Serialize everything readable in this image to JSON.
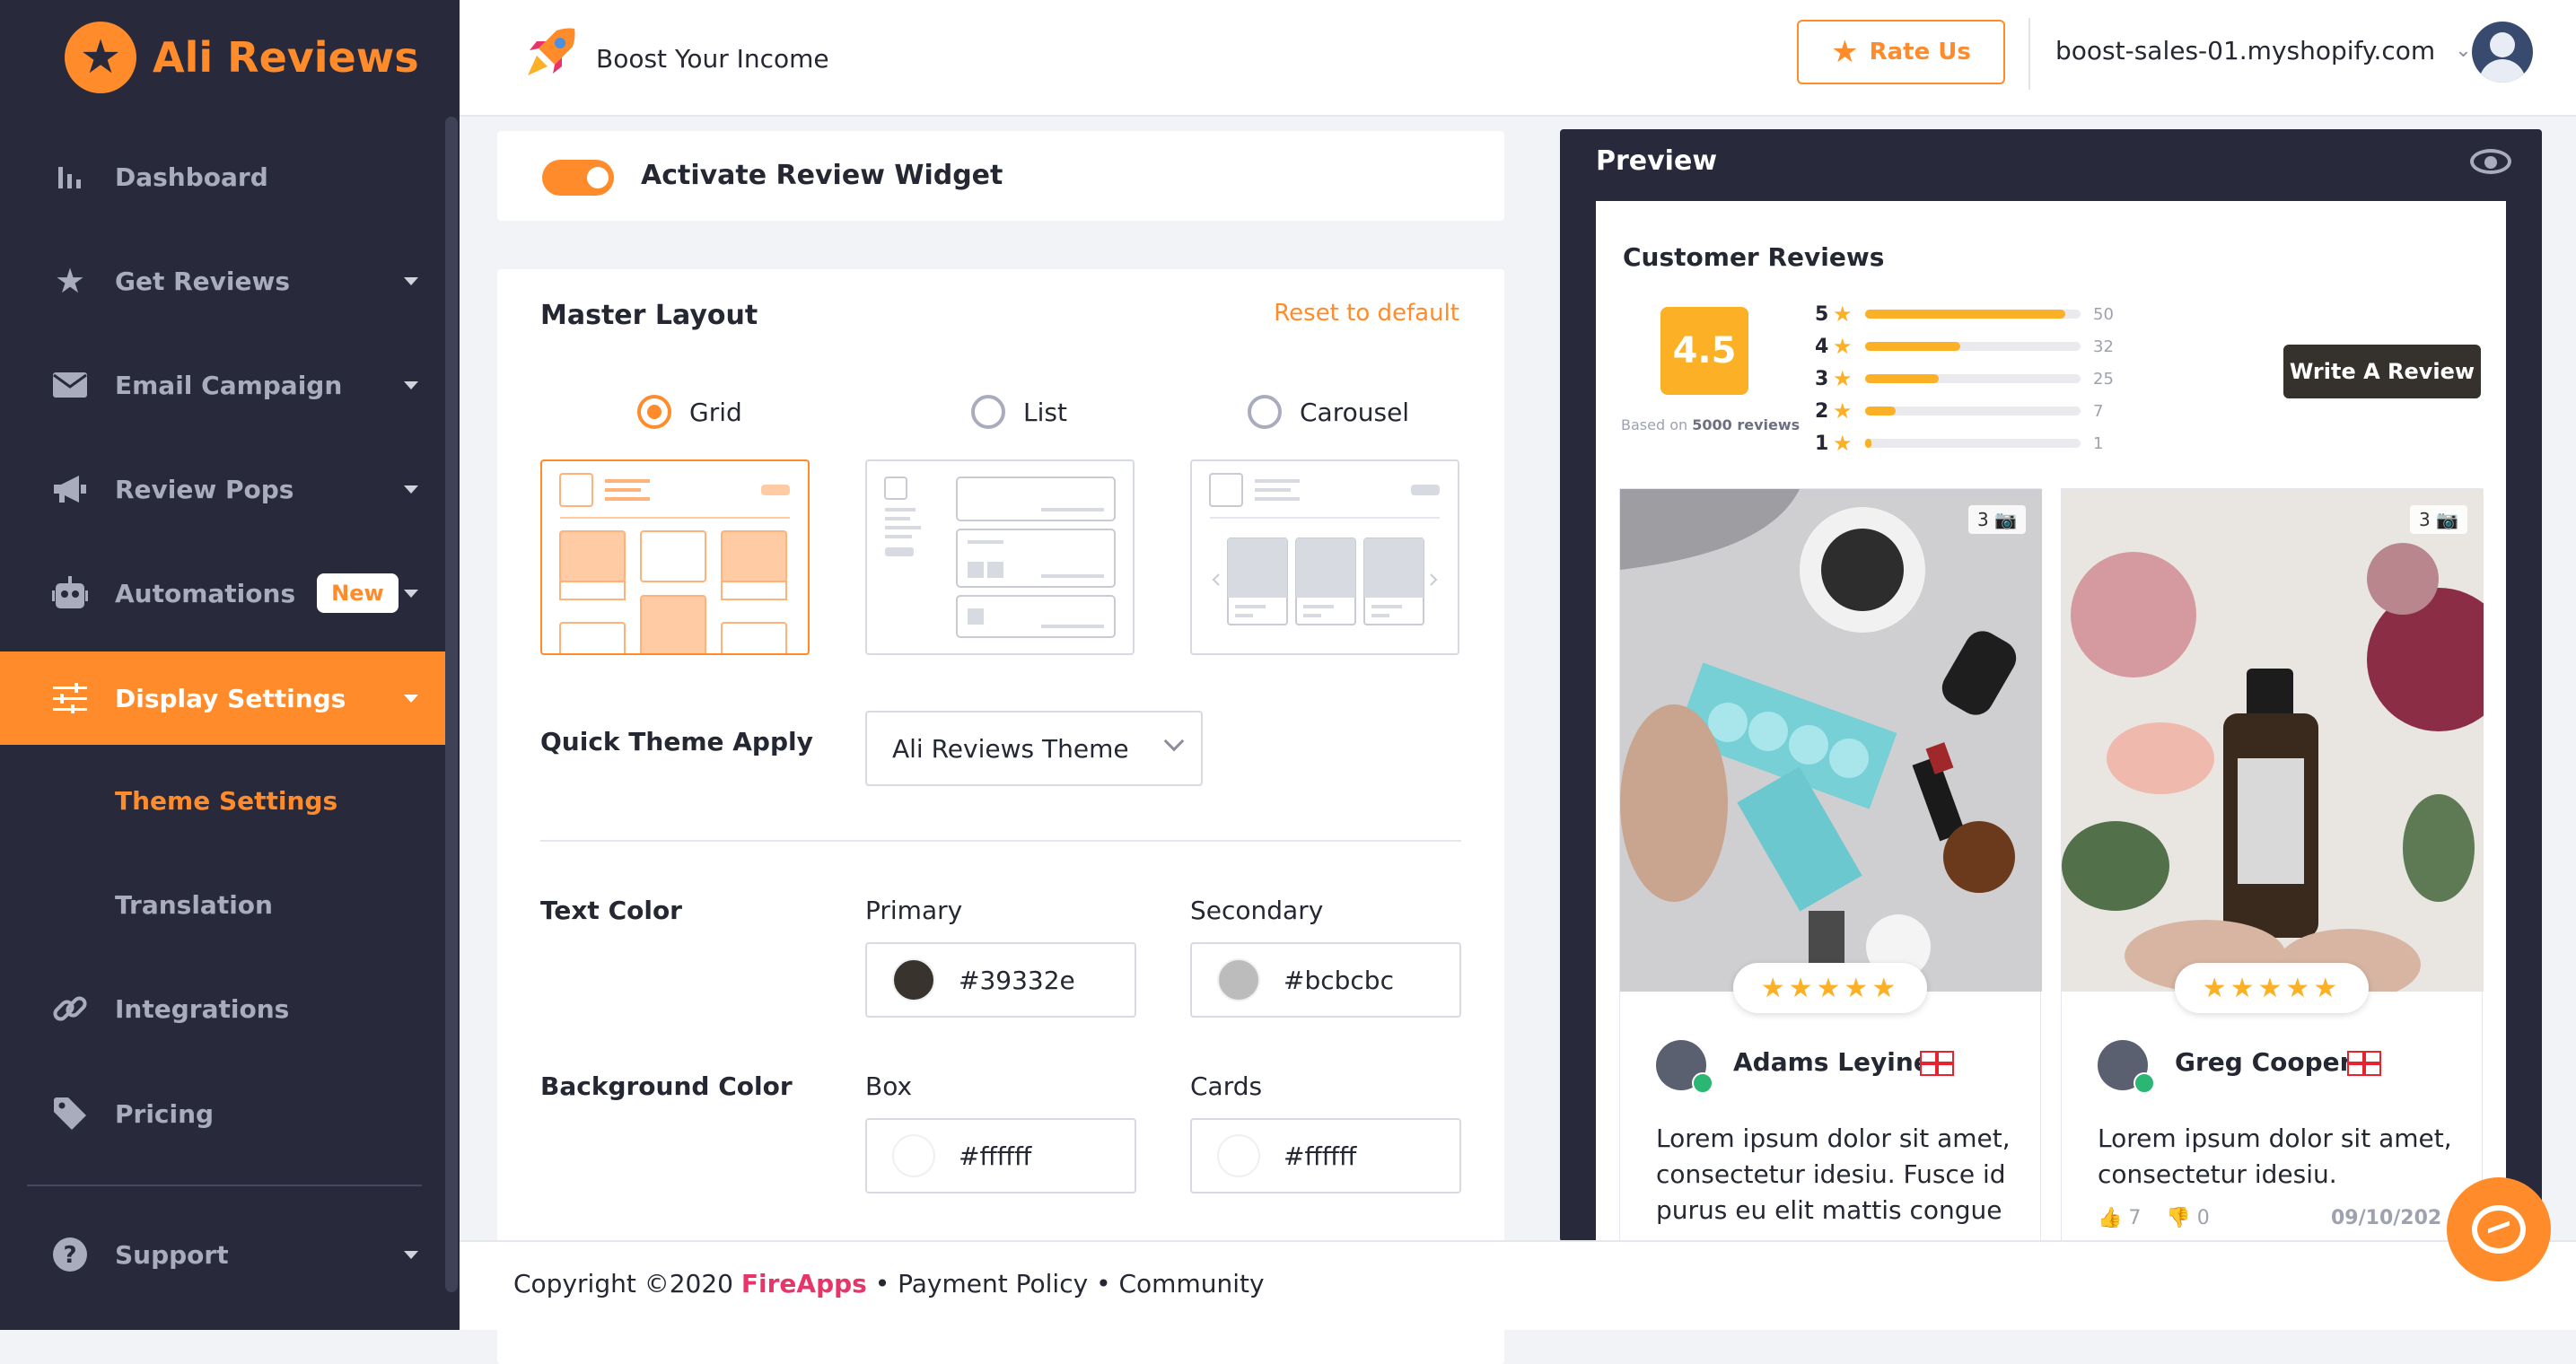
{
  "app": {
    "brand": "Ali Reviews"
  },
  "sidebar": {
    "items": [
      {
        "label": "Dashboard",
        "icon": "bar-chart-icon"
      },
      {
        "label": "Get Reviews",
        "icon": "star-icon"
      },
      {
        "label": "Email Campaign",
        "icon": "envelope-icon"
      },
      {
        "label": "Review Pops",
        "icon": "megaphone-icon"
      },
      {
        "label": "Automations",
        "icon": "robot-icon",
        "badge": "New"
      },
      {
        "label": "Display Settings",
        "icon": "sliders-icon"
      },
      {
        "label": "Integrations",
        "icon": "link-icon"
      },
      {
        "label": "Pricing",
        "icon": "tag-icon"
      },
      {
        "label": "Support",
        "icon": "question-icon"
      }
    ],
    "sub_items": [
      "Theme Settings",
      "Translation"
    ]
  },
  "header": {
    "boost": "Boost Your Income",
    "rate_us": "Rate Us",
    "store": "boost-sales-01.myshopify.com"
  },
  "widget": {
    "toggle_label": "Activate Review Widget",
    "enabled": true
  },
  "layout": {
    "title": "Master Layout",
    "reset": "Reset to default",
    "options": [
      "Grid",
      "List",
      "Carousel"
    ],
    "selected": "Grid"
  },
  "theme": {
    "label": "Quick Theme Apply",
    "value": "Ali Reviews Theme"
  },
  "text_color": {
    "label": "Text Color",
    "primary_label": "Primary",
    "primary": "#39332e",
    "secondary_label": "Secondary",
    "secondary": "#bcbcbc"
  },
  "bg_color": {
    "label": "Background Color",
    "box_label": "Box",
    "box": "#ffffff",
    "cards_label": "Cards",
    "cards": "#ffffff"
  },
  "preview": {
    "title": "Preview",
    "heading": "Customer Reviews",
    "score": "4.5",
    "based_prefix": "Based on",
    "based_count": "5000 reviews",
    "write": "Write A Review",
    "breakdown": [
      {
        "stars": "5",
        "count": "50",
        "fraction": 0.93
      },
      {
        "stars": "4",
        "count": "32",
        "fraction": 0.44
      },
      {
        "stars": "3",
        "count": "25",
        "fraction": 0.34
      },
      {
        "stars": "2",
        "count": "7",
        "fraction": 0.14
      },
      {
        "stars": "1",
        "count": "1",
        "fraction": 0.03
      }
    ],
    "reviews": [
      {
        "name": "Adams Leyine",
        "photos": "3",
        "text": "Lorem ipsum dolor sit amet, consectetur idesiu. Fusce id purus eu elit mattis congue",
        "likes": "",
        "dislikes": "",
        "date": ""
      },
      {
        "name": "Greg Cooper",
        "photos": "3",
        "text": "Lorem ipsum dolor sit amet, consectetur idesiu.",
        "likes": "7",
        "dislikes": "0",
        "date": "09/10/202"
      }
    ]
  },
  "footer": {
    "copyright": "Copyright ©2020 ",
    "brand": "FireApps",
    "links": " • Payment Policy • Community"
  },
  "colors": {
    "accent": "#ff8b2b",
    "sidebar": "#282a3c",
    "star": "#fbb025"
  }
}
